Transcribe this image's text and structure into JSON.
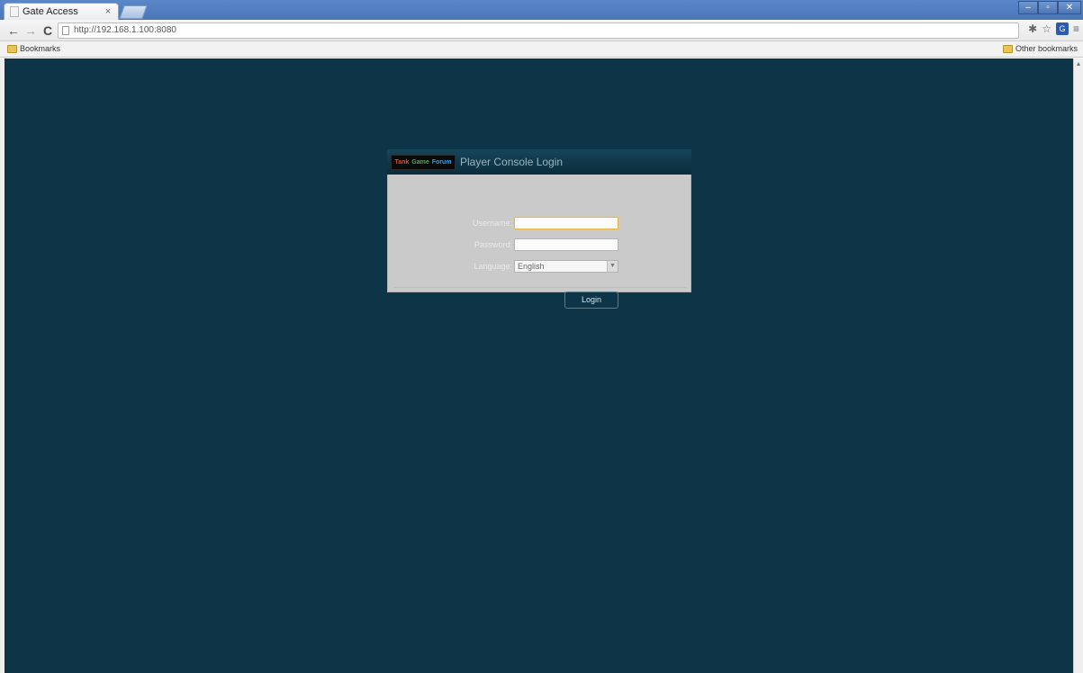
{
  "browser": {
    "tab_title": "Gate Access",
    "tab_close": "×",
    "url": "http://192.168.1.100:8080",
    "window_controls": {
      "minimize": "–",
      "maximize": "▫",
      "close": "✕"
    },
    "nav": {
      "back": "←",
      "forward": "→",
      "reload": "C"
    },
    "toolbar_icons": {
      "bookmark_star": "☆",
      "menu": "≡",
      "extension": "G",
      "pin": "✱"
    },
    "bookmarks_bar": {
      "left_item": "Bookmarks",
      "right_item": "Other bookmarks"
    }
  },
  "login": {
    "logo": {
      "part1": "Tank",
      "part2": "Game",
      "part3": "Forum"
    },
    "title": "Player Console Login",
    "fields": {
      "username_label": "Username:",
      "username_value": "",
      "password_label": "Password:",
      "password_value": "",
      "language_label": "Language:",
      "language_value": "English"
    },
    "submit_label": "Login"
  },
  "colors": {
    "page_background": "#0d3447",
    "login_body": "#cacaca",
    "focus_border": "#e4b64d"
  }
}
